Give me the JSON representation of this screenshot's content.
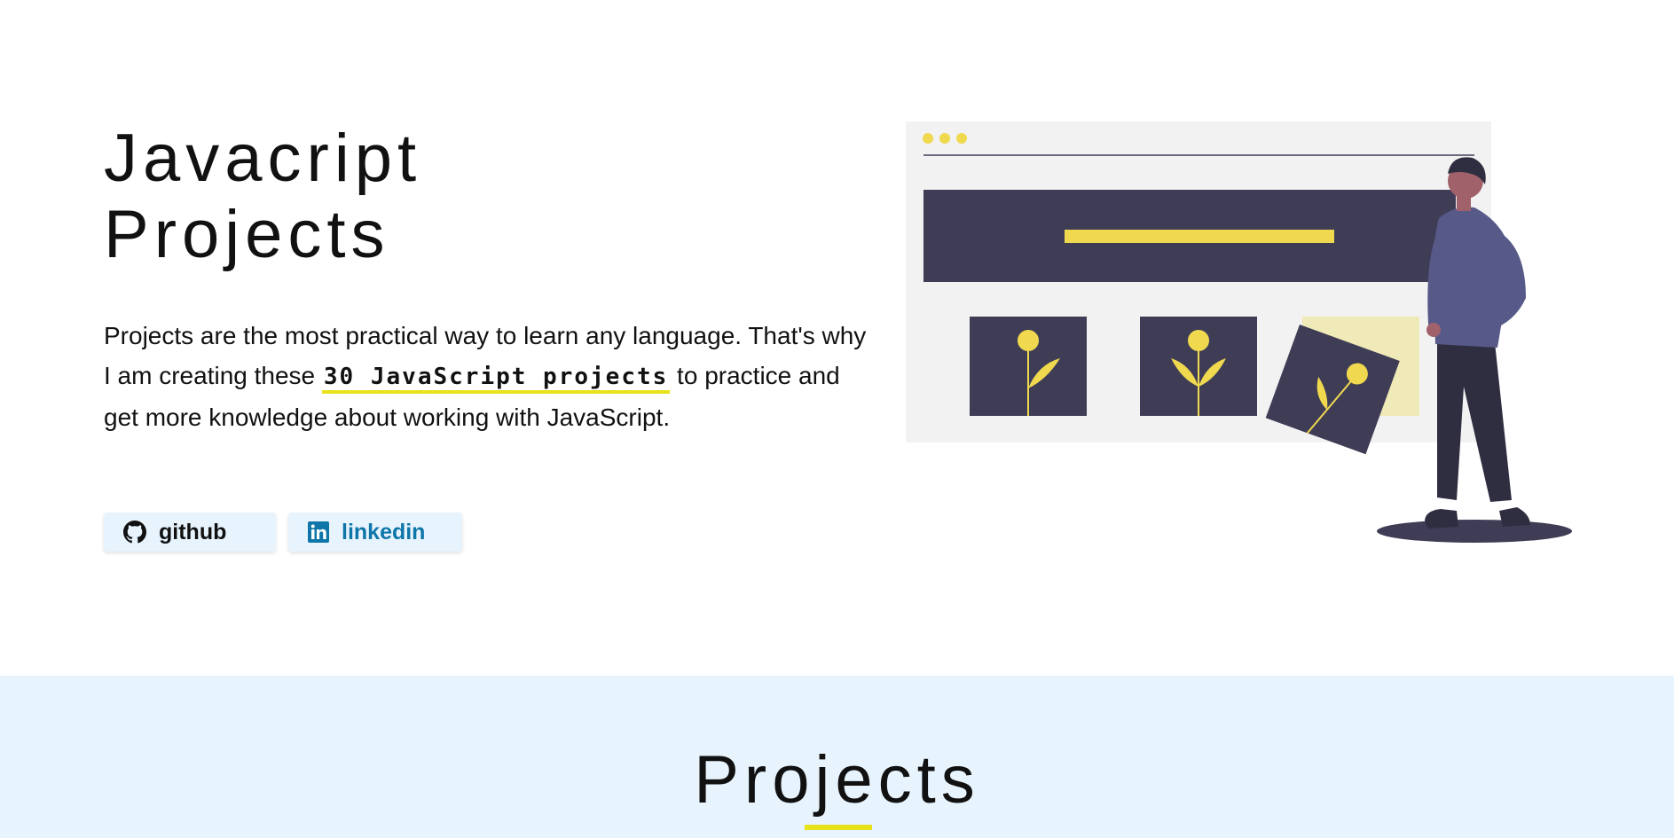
{
  "hero": {
    "title_line1": "Javacript",
    "title_line2": "Projects",
    "desc_before": "Projects are the most practical way to learn any language. That's why I am creating these ",
    "desc_highlight": "30 JavaScript projects",
    "desc_after": " to practice and get more knowledge about working with JavaScript."
  },
  "social": {
    "github_label": "github",
    "linkedin_label": "linkedin",
    "github_icon": "github-icon",
    "linkedin_icon": "linkedin-icon"
  },
  "projects": {
    "title": "Projects"
  },
  "colors": {
    "accent_yellow": "#e8e21a",
    "illustration_yellow": "#f0d94f",
    "dark_slate": "#3f3d56",
    "section_bg": "#e8f4fd",
    "linkedin_blue": "#0e76a8"
  }
}
